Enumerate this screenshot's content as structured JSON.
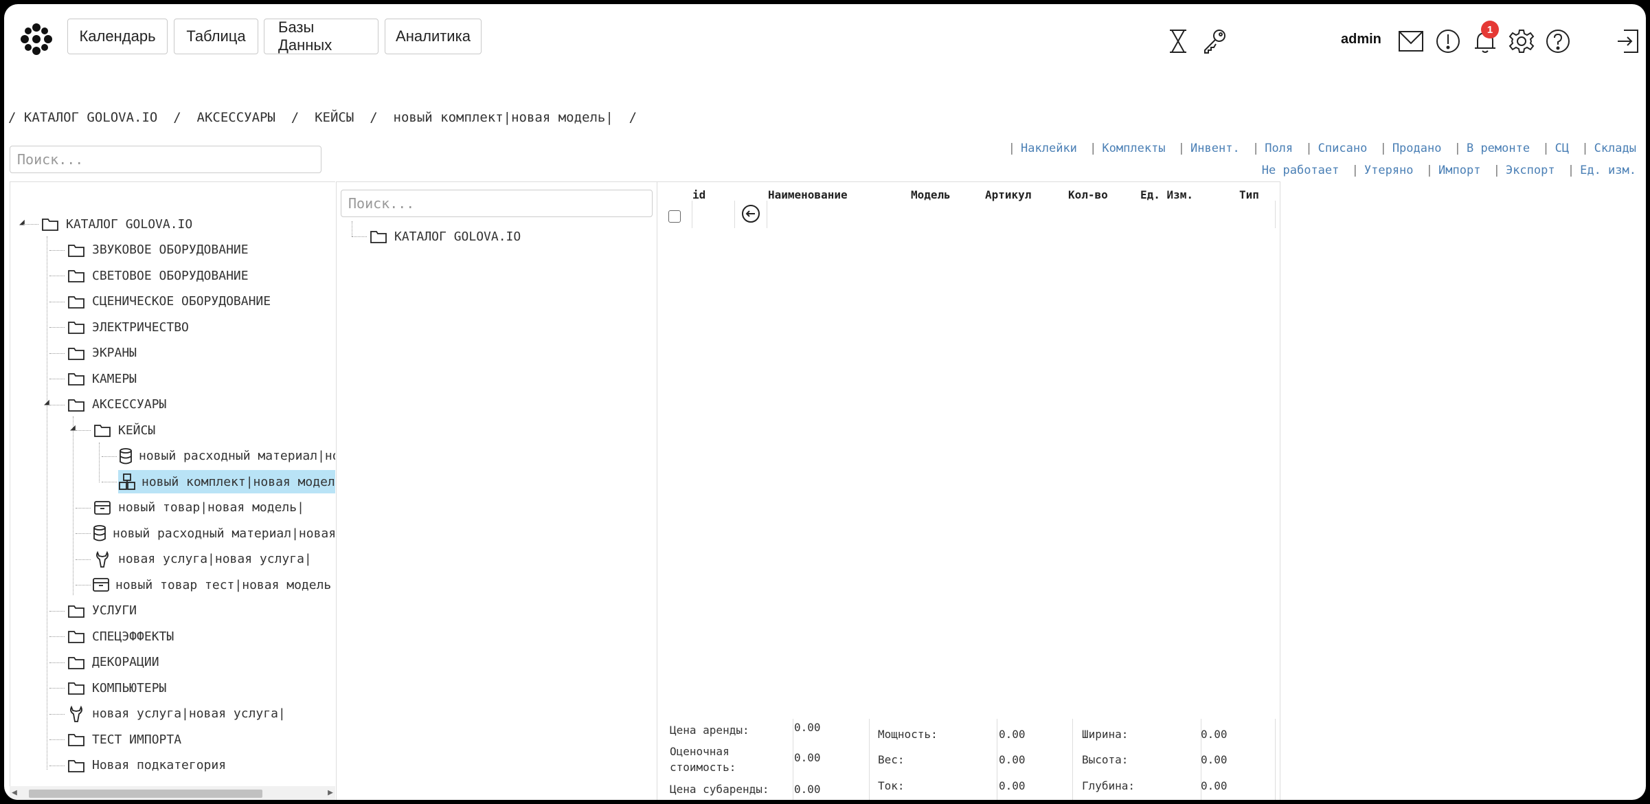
{
  "nav": {
    "calendar": "Календарь",
    "table": "Таблица",
    "databases": "Базы Данных",
    "analytics": "Аналитика"
  },
  "header": {
    "user": "admin",
    "notifications_count": "1",
    "icons": [
      "hourglass-icon",
      "key-icon",
      "mail-icon",
      "alert-icon",
      "bell-icon",
      "gear-icon",
      "help-icon",
      "logout-icon"
    ]
  },
  "breadcrumb": "/ КАТАЛОГ GOLOVA.IO  /  АКСЕССУАРЫ  /  КЕЙСЫ  /  новый комплект|новая модель|  /",
  "search": {
    "placeholder": "Поиск..."
  },
  "links_row1": [
    "Наклейки",
    "Комплекты",
    "Инвент.",
    "Поля",
    "Списано",
    "Продано",
    "В ремонте",
    "СЦ",
    "Склады"
  ],
  "links_row2": [
    "Не работает",
    "Утеряно",
    "Импорт",
    "Экспорт",
    "Ед. изм."
  ],
  "tree": {
    "root": "КАТАЛОГ GOLOVA.IO",
    "items": [
      {
        "label": "ЗВУКОВОЕ ОБОРУДОВАНИЕ",
        "icon": "folder-icon"
      },
      {
        "label": "СВЕТОВОЕ ОБОРУДОВАНИЕ",
        "icon": "folder-icon"
      },
      {
        "label": "СЦЕНИЧЕСКОЕ ОБОРУДОВАНИЕ",
        "icon": "folder-icon"
      },
      {
        "label": "ЭЛЕКТРИЧЕСТВО",
        "icon": "folder-icon"
      },
      {
        "label": "ЭКРАНЫ",
        "icon": "folder-icon"
      },
      {
        "label": "КАМЕРЫ",
        "icon": "folder-icon"
      },
      {
        "label": "АКСЕССУАРЫ",
        "icon": "folder-icon"
      },
      {
        "label": "КЕЙСЫ",
        "icon": "folder-icon"
      },
      {
        "label": "новый расходный материал|новая модель|",
        "icon": "cylinder-icon"
      },
      {
        "label": "новый комплект|новая модель|",
        "icon": "kit-icon",
        "selected": true
      },
      {
        "label": "новый товар|новая модель|",
        "icon": "box-icon"
      },
      {
        "label": "новый расходный материал|новая модель|",
        "icon": "cylinder-icon"
      },
      {
        "label": "новая услуга|новая услуга|",
        "icon": "wrench-icon"
      },
      {
        "label": "новый товар тест|новая модель тест|",
        "icon": "box-icon"
      },
      {
        "label": "УСЛУГИ",
        "icon": "folder-icon"
      },
      {
        "label": "СПЕЦЭФФЕКТЫ",
        "icon": "folder-icon"
      },
      {
        "label": "ДЕКОРАЦИИ",
        "icon": "folder-icon"
      },
      {
        "label": "КОМПЬЮТЕРЫ",
        "icon": "folder-icon"
      },
      {
        "label": "новая услуга|новая услуга|",
        "icon": "wrench-icon"
      },
      {
        "label": "ТЕСТ ИМПОРТА",
        "icon": "folder-icon"
      },
      {
        "label": "Новая подкатегория",
        "icon": "folder-icon"
      }
    ]
  },
  "tree2": {
    "root": "КАТАЛОГ GOLOVA.IO"
  },
  "table": {
    "columns": [
      "id",
      "Наименование",
      "Модель",
      "Артикул",
      "Кол-во",
      "Ед. Изм.",
      "Тип"
    ]
  },
  "props": {
    "rent_price": "Цена аренды:",
    "rent_price_val": "0.00",
    "est_cost_1": "Оценочная",
    "est_cost_2": "стоимость:",
    "est_cost_val": "0.00",
    "subrent_price": "Цена субаренды:",
    "subrent_price_val": "0.00",
    "power": "Мощность:",
    "power_val": "0.00",
    "weight": "Вес:",
    "weight_val": "0.00",
    "current": "Ток:",
    "current_val": "0.00",
    "width": "Ширина:",
    "width_val": "0.00",
    "height": "Высота:",
    "height_val": "0.00",
    "depth": "Глубина:",
    "depth_val": "0.00"
  }
}
